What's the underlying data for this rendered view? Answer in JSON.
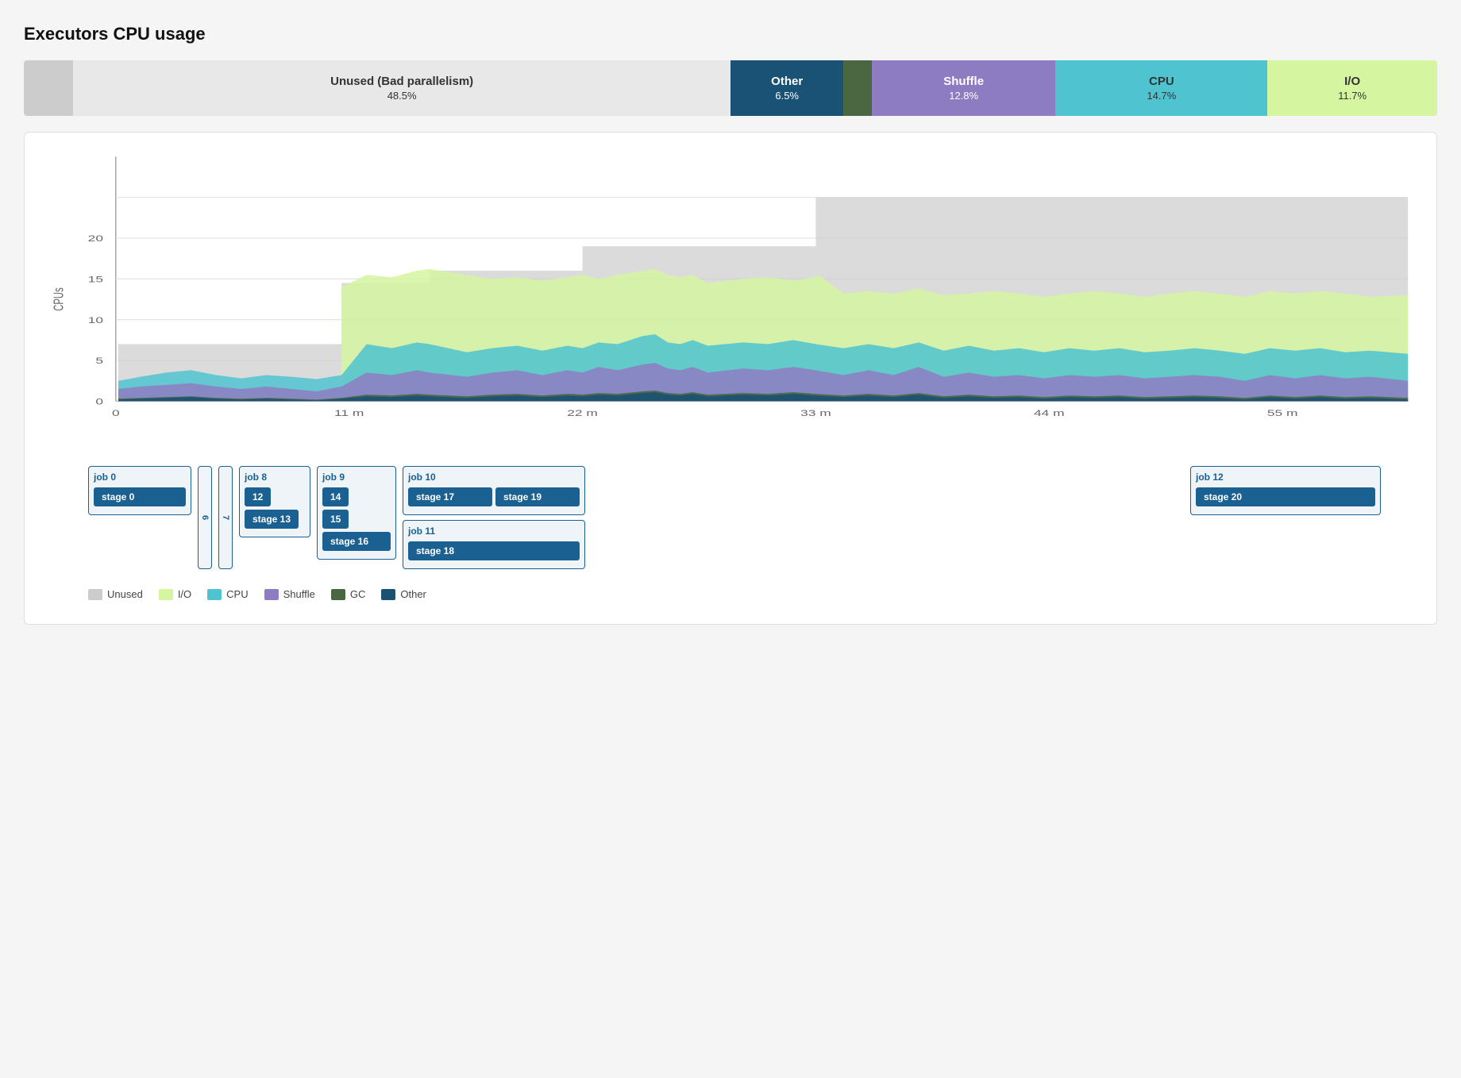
{
  "title": "Executors CPU usage",
  "summaryBar": {
    "segments": [
      {
        "id": "swatch",
        "label": "",
        "value": "",
        "color": "#cccccc",
        "width": "3.5%",
        "textColor": "#333"
      },
      {
        "id": "unused",
        "label": "Unused (Bad parallelism)",
        "value": "48.5%",
        "color": "#e8e8e8",
        "width": "46.5%",
        "textColor": "#333"
      },
      {
        "id": "other",
        "label": "Other",
        "value": "6.5%",
        "color": "#1a5276",
        "width": "8%",
        "textColor": "#fff"
      },
      {
        "id": "gc-swatch",
        "label": "",
        "value": "",
        "color": "#4a6741",
        "width": "2%",
        "textColor": "#333"
      },
      {
        "id": "shuffle",
        "label": "Shuffle",
        "value": "12.8%",
        "color": "#8e7cc3",
        "width": "13%",
        "textColor": "#fff"
      },
      {
        "id": "cpu",
        "label": "CPU",
        "value": "14.7%",
        "color": "#4fc3d0",
        "width": "15%",
        "textColor": "#333"
      },
      {
        "id": "io",
        "label": "I/O",
        "value": "11.7%",
        "color": "#d5f5a0",
        "width": "12%",
        "textColor": "#333"
      }
    ]
  },
  "chart": {
    "yAxisLabel": "CPUs",
    "yAxisTicks": [
      "0",
      "5",
      "10",
      "15",
      "20"
    ],
    "xAxisTicks": [
      "0",
      "11 m",
      "22 m",
      "33 m",
      "44 m",
      "55 m"
    ]
  },
  "legend": [
    {
      "id": "unused",
      "label": "Unused",
      "color": "#cccccc"
    },
    {
      "id": "io",
      "label": "I/O",
      "color": "#d5f5a0"
    },
    {
      "id": "cpu",
      "label": "CPU",
      "color": "#4fc3d0"
    },
    {
      "id": "shuffle",
      "label": "Shuffle",
      "color": "#8e7cc3"
    },
    {
      "id": "gc",
      "label": "GC",
      "color": "#4a6741"
    },
    {
      "id": "other",
      "label": "Other",
      "color": "#1a5276"
    }
  ],
  "jobs": [
    {
      "id": "job0",
      "label": "job 0",
      "stages": [
        [
          "stage 0"
        ]
      ],
      "wide": true
    },
    {
      "id": "mini6",
      "label": "6",
      "mini": true
    },
    {
      "id": "mini7",
      "label": "7",
      "mini": true
    },
    {
      "id": "job8",
      "label": "job 8",
      "stages": [
        [
          "12"
        ],
        [
          "stage 13"
        ]
      ]
    },
    {
      "id": "job9",
      "label": "job 9",
      "stages": [
        [
          "14"
        ],
        [
          "15"
        ],
        [
          "stage 16"
        ]
      ]
    },
    {
      "id": "job10",
      "label": "job 10",
      "stages": [
        [
          "stage 17",
          "stage 19"
        ]
      ]
    },
    {
      "id": "job11",
      "label": "job 11",
      "stages": [
        [
          "stage 18"
        ]
      ]
    },
    {
      "id": "job12",
      "label": "job 12",
      "stages": [
        [
          "stage 20"
        ]
      ]
    }
  ]
}
